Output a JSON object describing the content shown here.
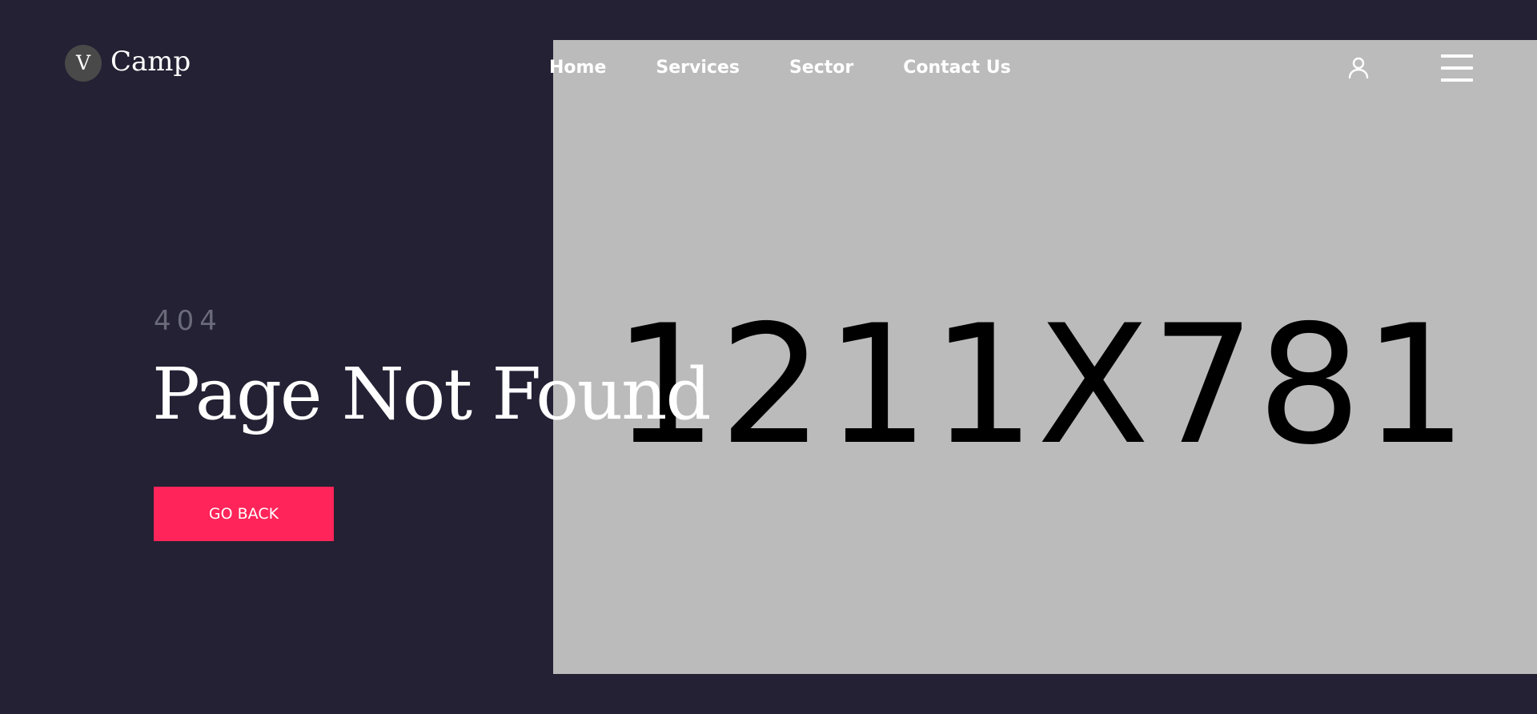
{
  "header": {
    "logo_mark": "V",
    "logo_text": "Camp",
    "nav": {
      "home": "Home",
      "services": "Services",
      "sector": "Sector",
      "contact": "Contact Us"
    },
    "icons": {
      "account": "user-icon",
      "menu": "hamburger-menu-icon"
    }
  },
  "hero": {
    "error_code": "404",
    "title": "Page Not Found",
    "button_label": "GO BACK"
  },
  "placeholder": {
    "label": "1211X781"
  },
  "colors": {
    "background": "#232133",
    "placeholder_bg": "#bbbbbb",
    "accent": "#ff2459",
    "muted_text": "#6b6a7a",
    "logo_circle": "#4a4949"
  }
}
